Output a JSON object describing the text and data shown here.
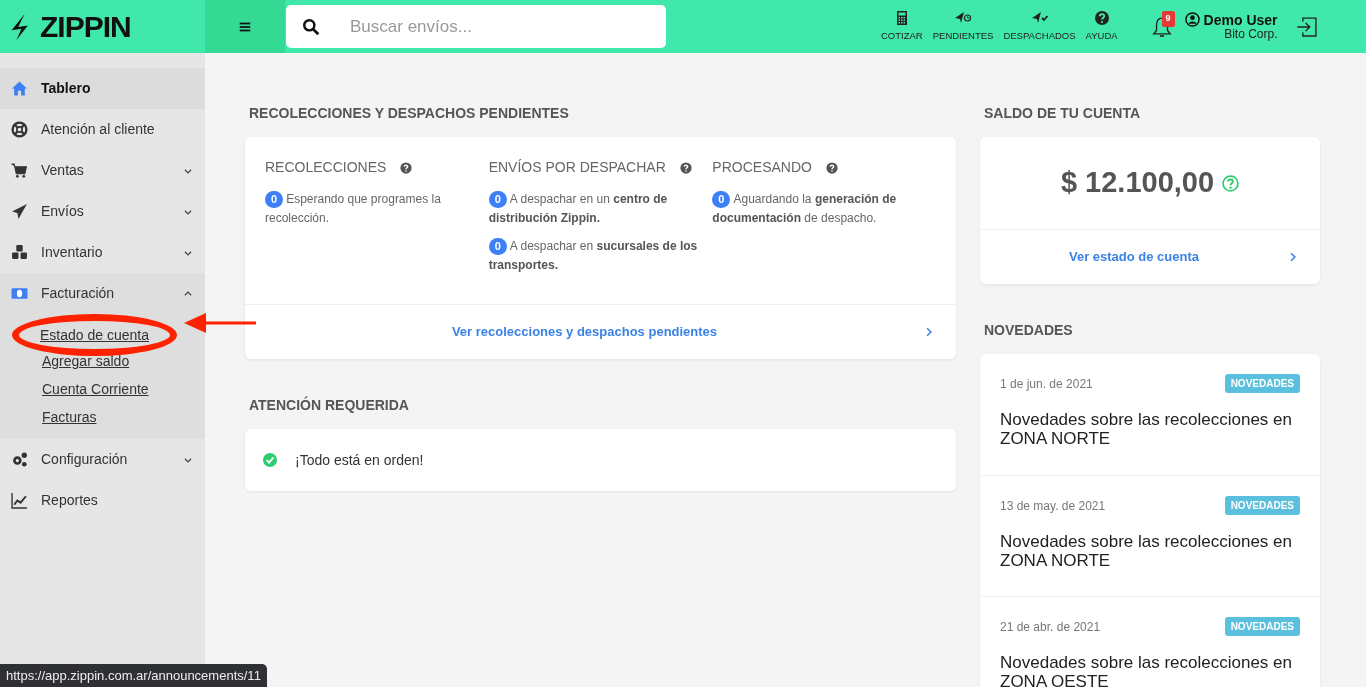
{
  "brand": {
    "name": "ZIPPIN"
  },
  "search": {
    "placeholder": "Buscar envíos..."
  },
  "toolbar": [
    {
      "kind": "calc",
      "label": "COTIZAR"
    },
    {
      "kind": "pending",
      "label": "PENDIENTES"
    },
    {
      "kind": "sent",
      "label": "DESPACHADOS"
    },
    {
      "kind": "help",
      "label": "AYUDA"
    }
  ],
  "notifications": {
    "count": "9"
  },
  "user": {
    "name": "Demo User",
    "company": "Bito Corp."
  },
  "sidebar": {
    "items": [
      {
        "label": "Tablero",
        "selected": true
      },
      {
        "label": "Atención al cliente",
        "selected": false
      },
      {
        "label": "Ventas",
        "selected": false,
        "expanded": false
      },
      {
        "label": "Envíos",
        "selected": false,
        "expanded": false
      },
      {
        "label": "Inventario",
        "selected": false,
        "expanded": false
      },
      {
        "label": "Facturación",
        "selected": false,
        "expanded": true,
        "children": [
          {
            "label": "Estado de cuenta",
            "highlighted": true
          },
          {
            "label": "Agregar saldo",
            "highlighted": false
          },
          {
            "label": "Cuenta Corriente",
            "highlighted": false
          },
          {
            "label": "Facturas",
            "highlighted": false
          }
        ]
      },
      {
        "label": "Configuración",
        "selected": false,
        "expanded": false
      },
      {
        "label": "Reportes",
        "selected": false
      }
    ]
  },
  "pending": {
    "title": "RECOLECCIONES Y DESPACHOS PENDIENTES",
    "columns": [
      {
        "heading": "RECOLECCIONES",
        "entries": [
          {
            "count": "0",
            "text": "Esperando que programes la recolección."
          }
        ]
      },
      {
        "heading": "ENVÍOS POR DESPACHAR",
        "entries": [
          {
            "count": "0",
            "text": "A despachar en un **centro de distribución Zippin.**"
          },
          {
            "count": "0",
            "text": "A despachar en **sucursales de los transportes.**"
          }
        ]
      },
      {
        "heading": "PROCESANDO",
        "entries": [
          {
            "count": "0",
            "text": "Aguardando la **generación de documentación** de despacho."
          }
        ]
      }
    ],
    "link": "Ver recolecciones y despachos pendientes"
  },
  "attention": {
    "title": "ATENCIÓN REQUERIDA",
    "message": "¡Todo está en orden!"
  },
  "balance": {
    "title": "SALDO DE TU CUENTA",
    "amount": "$ 12.100,00",
    "link": "Ver estado de cuenta"
  },
  "news": {
    "title": "NOVEDADES",
    "items": [
      {
        "date": "1 de jun. de 2021",
        "tag": "NOVEDADES",
        "title": "Novedades sobre las recolecciones en ZONA NORTE"
      },
      {
        "date": "13 de may. de 2021",
        "tag": "NOVEDADES",
        "title": "Novedades sobre las recolecciones en ZONA NORTE"
      },
      {
        "date": "21 de abr. de 2021",
        "tag": "NOVEDADES",
        "title": "Novedades sobre las recolecciones en ZONA OESTE"
      }
    ]
  },
  "status_url": "https://app.zippin.com.ar/announcements/11"
}
